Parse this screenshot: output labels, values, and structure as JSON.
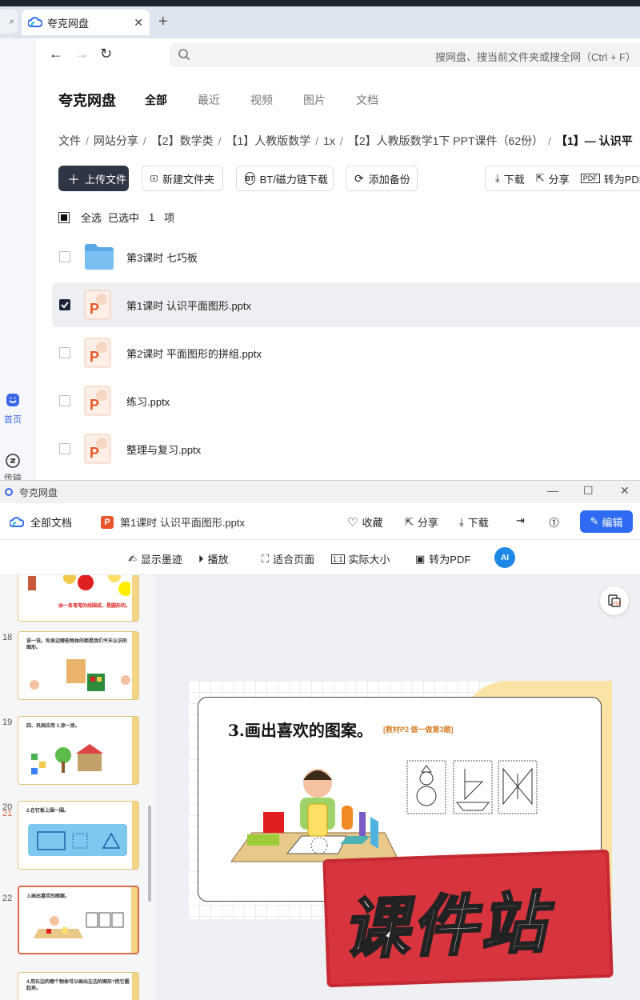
{
  "browser": {
    "tab_title": "夸克网盘",
    "address_placeholder": "搜网盘、搜当前文件夹或搜全网（Ctrl + F）"
  },
  "left_rail": {
    "home_label": "首页",
    "transfer_label": "传输"
  },
  "pan": {
    "brand": "夸克网盘",
    "nav": [
      "全部",
      "最近",
      "视频",
      "图片",
      "文档"
    ],
    "breadcrumb": [
      "文件",
      "网站分享",
      "【2】数学类",
      "【1】人教版数学",
      "1x",
      "【2】人教版数学1下 PPT课件（62份）",
      "【1】— 认识平"
    ],
    "toolbar": {
      "upload": "上传文件",
      "new_folder": "新建文件夹",
      "bt_download": "BT/磁力链下载",
      "add_backup": "添加备份",
      "download": "下载",
      "share": "分享",
      "to_pdf": "转为PDF"
    },
    "select_all": "全选",
    "selected_text": "已选中",
    "selected_count": "1",
    "selected_unit": "项",
    "files": [
      {
        "name": "第3课时 七巧板",
        "type": "folder",
        "checked": false
      },
      {
        "name": "第1课时 认识平面图形.pptx",
        "type": "pptx",
        "checked": true
      },
      {
        "name": "第2课时 平面图形的拼组.pptx",
        "type": "pptx",
        "checked": false
      },
      {
        "name": "练习.pptx",
        "type": "pptx",
        "checked": false
      },
      {
        "name": "整理与复习.pptx",
        "type": "pptx",
        "checked": false
      }
    ]
  },
  "viewer": {
    "window_title": "夸克网盘",
    "all_docs": "全部文档",
    "file_name": "第1课时 认识平面图形.pptx",
    "actions": {
      "favorite": "收藏",
      "share": "分享",
      "download": "下载",
      "edit": "编辑"
    },
    "tools": {
      "ink": "显示墨迹",
      "play": "播放",
      "fit_page": "适合页面",
      "actual_size": "实际大小",
      "to_pdf": "转为PDF",
      "ai": "AI"
    },
    "thumbnails": [
      {
        "num": "",
        "text": "由一条弯弯的线围成，是圆形的。",
        "active": false
      },
      {
        "num": "18",
        "text": "说一说。你身边哪些物体的面是我们今天认识的图形。",
        "active": false
      },
      {
        "num": "19",
        "text": "四、巩固应用  1.涂一涂。",
        "active": false
      },
      {
        "num": "20",
        "text": "2.在钉板上围一围。",
        "active": false
      },
      {
        "num": "21",
        "text": "3.画出喜欢的图案。",
        "active": true
      },
      {
        "num": "22",
        "text": "4.用右边的哪个物体可以画出左边的图形?把它圈起来。",
        "active": false
      }
    ],
    "slide": {
      "title": "3.画出喜欢的图案。",
      "note": "[教材P2 做一做第3题]"
    }
  },
  "watermark": "课件站",
  "colors": {
    "accent": "#2f6bf2",
    "upload_btn": "#2f3545",
    "ppt_orange": "#e8562a",
    "watermark_red": "#d8343e"
  }
}
